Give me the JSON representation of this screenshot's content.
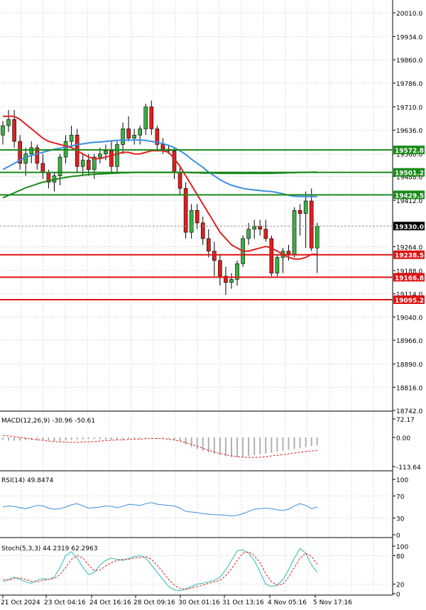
{
  "chart_data": {
    "type": "candlestick",
    "price_panel": {
      "ylim": [
        18742.0,
        20010.0
      ],
      "y_ticks": [
        "20010.0",
        "19934.0",
        "19860.0",
        "19786.0",
        "19710.0",
        "19636.0",
        "19560.0",
        "19488.0",
        "19412.0",
        "19264.0",
        "19188.0",
        "19114.0",
        "19040.0",
        "18966.0",
        "18890.0",
        "18816.0",
        "18742.0"
      ],
      "current_price": "19330.0",
      "levels": [
        {
          "value": 19572.8,
          "label": "19572.8",
          "color": "#1a8a1a"
        },
        {
          "value": 19501.2,
          "label": "19501.2",
          "color": "#1a8a1a"
        },
        {
          "value": 19429.5,
          "label": "19429.5",
          "color": "#1a8a1a"
        },
        {
          "value": 19238.5,
          "label": "19238.5",
          "color": "#dd1111"
        },
        {
          "value": 19166.8,
          "label": "19166.8",
          "color": "#dd1111"
        },
        {
          "value": 19095.2,
          "label": "19095.2",
          "color": "#dd1111"
        }
      ],
      "candles": [
        [
          19620,
          19665,
          19590,
          19650
        ],
        [
          19650,
          19700,
          19630,
          19670
        ],
        [
          19670,
          19700,
          19580,
          19600
        ],
        [
          19600,
          19620,
          19510,
          19530
        ],
        [
          19530,
          19580,
          19490,
          19560
        ],
        [
          19560,
          19600,
          19530,
          19580
        ],
        [
          19580,
          19590,
          19510,
          19530
        ],
        [
          19530,
          19560,
          19480,
          19500
        ],
        [
          19500,
          19510,
          19450,
          19470
        ],
        [
          19470,
          19500,
          19440,
          19490
        ],
        [
          19490,
          19560,
          19460,
          19550
        ],
        [
          19550,
          19620,
          19530,
          19600
        ],
        [
          19600,
          19650,
          19580,
          19620
        ],
        [
          19620,
          19640,
          19500,
          19520
        ],
        [
          19520,
          19560,
          19490,
          19540
        ],
        [
          19540,
          19560,
          19490,
          19510
        ],
        [
          19510,
          19560,
          19480,
          19550
        ],
        [
          19550,
          19580,
          19530,
          19560
        ],
        [
          19560,
          19590,
          19540,
          19570
        ],
        [
          19570,
          19600,
          19500,
          19520
        ],
        [
          19520,
          19600,
          19500,
          19590
        ],
        [
          19590,
          19660,
          19560,
          19640
        ],
        [
          19640,
          19680,
          19600,
          19610
        ],
        [
          19610,
          19640,
          19590,
          19620
        ],
        [
          19620,
          19650,
          19590,
          19640
        ],
        [
          19640,
          19720,
          19620,
          19710
        ],
        [
          19710,
          19730,
          19620,
          19640
        ],
        [
          19640,
          19650,
          19570,
          19590
        ],
        [
          19590,
          19610,
          19560,
          19575
        ],
        [
          19575,
          19590,
          19560,
          19570
        ],
        [
          19570,
          19580,
          19480,
          19500
        ],
        [
          19500,
          19520,
          19430,
          19450
        ],
        [
          19450,
          19470,
          19290,
          19310
        ],
        [
          19310,
          19400,
          19290,
          19380
        ],
        [
          19380,
          19400,
          19320,
          19340
        ],
        [
          19340,
          19360,
          19270,
          19290
        ],
        [
          19290,
          19320,
          19230,
          19250
        ],
        [
          19250,
          19280,
          19170,
          19220
        ],
        [
          19220,
          19240,
          19140,
          19170
        ],
        [
          19170,
          19200,
          19110,
          19150
        ],
        [
          19150,
          19180,
          19130,
          19160
        ],
        [
          19160,
          19220,
          19140,
          19210
        ],
        [
          19210,
          19300,
          19200,
          19290
        ],
        [
          19290,
          19340,
          19270,
          19320
        ],
        [
          19320,
          19350,
          19290,
          19330
        ],
        [
          19330,
          19350,
          19300,
          19320
        ],
        [
          19320,
          19350,
          19280,
          19290
        ],
        [
          19290,
          19300,
          19170,
          19180
        ],
        [
          19180,
          19240,
          19170,
          19230
        ],
        [
          19230,
          19260,
          19180,
          19250
        ],
        [
          19250,
          19270,
          19220,
          19240
        ],
        [
          19240,
          19390,
          19230,
          19380
        ],
        [
          19380,
          19400,
          19300,
          19370
        ],
        [
          19370,
          19440,
          19260,
          19410
        ],
        [
          19410,
          19450,
          19250,
          19260
        ],
        [
          19260,
          19340,
          19180,
          19330
        ]
      ],
      "ma_fast": [
        19680,
        19680,
        19680,
        19670,
        19655,
        19640,
        19625,
        19610,
        19600,
        19595,
        19590,
        19585,
        19580,
        19570,
        19560,
        19550,
        19545,
        19545,
        19550,
        19555,
        19560,
        19565,
        19565,
        19560,
        19560,
        19565,
        19570,
        19570,
        19570,
        19565,
        19545,
        19520,
        19490,
        19460,
        19430,
        19400,
        19370,
        19340,
        19310,
        19290,
        19270,
        19260,
        19250,
        19250,
        19255,
        19260,
        19265,
        19260,
        19250,
        19240,
        19230,
        19225,
        19225,
        19230,
        19240,
        19240
      ],
      "ma_mid": [
        19510,
        19520,
        19530,
        19540,
        19550,
        19555,
        19560,
        19565,
        19570,
        19575,
        19578,
        19582,
        19585,
        19590,
        19592,
        19595,
        19597,
        19598,
        19600,
        19602,
        19603,
        19604,
        19604,
        19604,
        19604,
        19603,
        19600,
        19597,
        19593,
        19587,
        19580,
        19570,
        19558,
        19543,
        19530,
        19517,
        19502,
        19490,
        19478,
        19468,
        19460,
        19455,
        19450,
        19447,
        19445,
        19443,
        19441,
        19440,
        19437,
        19433,
        19428,
        19425,
        19424,
        19424,
        19424,
        19424
      ],
      "ma_slow": [
        19420,
        19428,
        19436,
        19444,
        19452,
        19458,
        19464,
        19470,
        19474,
        19478,
        19482,
        19485,
        19488,
        19490,
        19492,
        19494,
        19495,
        19496,
        19497,
        19498,
        19499,
        19500,
        19500,
        19501,
        19501,
        19501,
        19501,
        19501,
        19501,
        19501,
        19501,
        19501,
        19501,
        19500,
        19500,
        19499,
        19499,
        19499,
        19498,
        19498,
        19498,
        19498,
        19498,
        19498,
        19498,
        19498,
        19498,
        19498,
        19499,
        19499,
        19500,
        19500,
        19501,
        19501,
        19502,
        19502
      ]
    },
    "macd_panel": {
      "label": "MACD(12,26,9) -30.96 -50.61",
      "y_ticks": [
        "72.17",
        "0.00",
        "-113.64"
      ],
      "ylim": [
        -113.64,
        72.17
      ],
      "histogram": [
        -10,
        -12,
        -13,
        -12,
        -11,
        -10,
        -9,
        -10,
        -12,
        -14,
        -13,
        -11,
        -9,
        -8,
        -7,
        -6,
        -6,
        -7,
        -8,
        -9,
        -9,
        -8,
        -6,
        -5,
        -4,
        -3,
        -2,
        -2,
        -3,
        -5,
        -9,
        -15,
        -28,
        -38,
        -45,
        -52,
        -58,
        -63,
        -68,
        -73,
        -76,
        -77,
        -76,
        -73,
        -69,
        -65,
        -62,
        -60,
        -56,
        -52,
        -48,
        -45,
        -42,
        -38,
        -34,
        -31
      ],
      "signal": [
        8,
        6,
        3,
        0,
        -3,
        -6,
        -9,
        -11,
        -14,
        -16,
        -17,
        -18,
        -19,
        -19,
        -18,
        -17,
        -16,
        -14,
        -12,
        -11,
        -10,
        -9,
        -8,
        -7,
        -6,
        -5,
        -4,
        -4,
        -5,
        -7,
        -10,
        -14,
        -20,
        -27,
        -34,
        -42,
        -50,
        -57,
        -63,
        -68,
        -72,
        -75,
        -77,
        -78,
        -78,
        -77,
        -75,
        -72,
        -70,
        -67,
        -64,
        -61,
        -58,
        -55,
        -53,
        -51
      ]
    },
    "rsi_panel": {
      "label": "RSI(14) 49.8474",
      "y_ticks": [
        "100",
        "70",
        "30",
        "0"
      ],
      "ylim": [
        0,
        100
      ],
      "values": [
        50,
        52,
        51,
        49,
        47,
        50,
        53,
        52,
        48,
        46,
        47,
        50,
        54,
        56,
        52,
        48,
        49,
        50,
        52,
        51,
        49,
        51,
        55,
        54,
        53,
        56,
        58,
        55,
        54,
        53,
        52,
        48,
        42,
        41,
        40,
        38,
        37,
        36,
        36,
        35,
        34,
        35,
        38,
        42,
        46,
        47,
        48,
        47,
        45,
        44,
        46,
        52,
        56,
        53,
        47,
        50
      ]
    },
    "stoch_panel": {
      "label": "Stoch(5,3,3) 44.2319 62.2963",
      "y_ticks": [
        "100",
        "80",
        "20",
        "0"
      ],
      "ylim": [
        0,
        100
      ],
      "k": [
        25,
        30,
        35,
        30,
        25,
        22,
        28,
        32,
        30,
        35,
        55,
        80,
        88,
        75,
        55,
        40,
        45,
        60,
        70,
        75,
        72,
        70,
        74,
        78,
        80,
        75,
        60,
        45,
        30,
        15,
        8,
        6,
        10,
        15,
        20,
        22,
        25,
        28,
        35,
        50,
        70,
        90,
        92,
        85,
        70,
        45,
        20,
        15,
        18,
        30,
        50,
        75,
        95,
        85,
        60,
        45
      ],
      "d": [
        30,
        28,
        32,
        33,
        30,
        26,
        25,
        28,
        30,
        32,
        40,
        55,
        72,
        80,
        75,
        60,
        48,
        50,
        58,
        65,
        70,
        72,
        72,
        75,
        76,
        78,
        72,
        60,
        45,
        30,
        18,
        10,
        9,
        12,
        15,
        18,
        22,
        25,
        28,
        38,
        52,
        70,
        85,
        88,
        80,
        65,
        42,
        25,
        18,
        20,
        35,
        55,
        75,
        85,
        78,
        62
      ]
    },
    "x_labels": [
      "21 Oct 2024",
      "23 Oct 04:16",
      "24 Oct 16:16",
      "28 Oct 09:16",
      "30 Oct 01:16",
      "31 Oct 13:16",
      "4 Nov 05:16",
      "5 Nov 17:16"
    ]
  }
}
